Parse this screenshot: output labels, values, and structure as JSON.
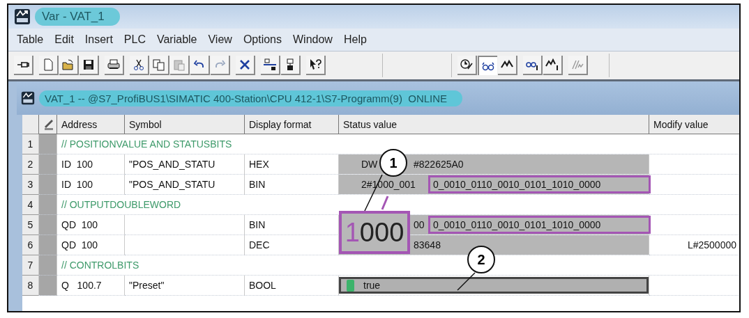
{
  "window": {
    "title": "Var - VAT_1"
  },
  "menu": [
    "Table",
    "Edit",
    "Insert",
    "PLC",
    "Variable",
    "View",
    "Options",
    "Window",
    "Help"
  ],
  "toolbars": [
    [
      [
        {
          "kind": "pin",
          "disabled": false,
          "pressed": false
        }
      ],
      [
        {
          "kind": "new",
          "disabled": false,
          "pressed": false
        },
        {
          "kind": "open",
          "disabled": false,
          "pressed": false
        },
        {
          "kind": "save",
          "disabled": false,
          "pressed": false
        }
      ],
      [
        {
          "kind": "print",
          "disabled": false,
          "pressed": false
        }
      ],
      [
        {
          "kind": "cut",
          "disabled": false,
          "pressed": false
        },
        {
          "kind": "copy",
          "disabled": false,
          "pressed": false
        },
        {
          "kind": "paste",
          "disabled": true,
          "pressed": false
        },
        {
          "kind": "undo",
          "disabled": false,
          "pressed": false
        },
        {
          "kind": "redo",
          "disabled": true,
          "pressed": false
        }
      ],
      [
        {
          "kind": "delete",
          "disabled": false,
          "pressed": false
        }
      ],
      [
        {
          "kind": "network",
          "disabled": false,
          "pressed": false
        },
        {
          "kind": "station",
          "disabled": false,
          "pressed": false
        }
      ],
      [
        {
          "kind": "help",
          "disabled": false,
          "pressed": false
        }
      ]
    ],
    [
      [
        {
          "kind": "monitor",
          "disabled": false,
          "pressed": false
        },
        {
          "kind": "glasses",
          "disabled": false,
          "pressed": true
        },
        {
          "kind": "modify",
          "disabled": false,
          "pressed": false
        }
      ],
      [
        {
          "kind": "glasses-trigger",
          "disabled": false,
          "pressed": false
        },
        {
          "kind": "modify-trigger",
          "disabled": false,
          "pressed": false
        }
      ],
      [
        {
          "kind": "force",
          "disabled": true,
          "pressed": false
        }
      ]
    ]
  ],
  "document": {
    "title": "VAT_1 -- @S7_ProfiBUS1\\SIMATIC 400-Station\\CPU 412-1\\S7-Programm(9)  ONLINE"
  },
  "table": {
    "columns": [
      "Address",
      "Symbol",
      "Display format",
      "Status value",
      "Modify value"
    ],
    "rows": [
      {
        "number": "1",
        "kind": "comment",
        "text": "// POSITIONVALUE AND STATUSBITS"
      },
      {
        "number": "2",
        "kind": "variable",
        "address": "ID  100",
        "symbol": "\"POS_AND_STATU",
        "format": "HEX",
        "status": {
          "kind": "value",
          "segments": [
            {
              "kind": "lead",
              "text": "DW"
            },
            {
              "kind": "after",
              "text": "#822625A0"
            }
          ]
        }
      },
      {
        "number": "3",
        "kind": "variable",
        "address": "ID  100",
        "symbol": "\"POS_AND_STATU",
        "format": "BIN",
        "status": {
          "kind": "value",
          "segments": [
            {
              "kind": "lead",
              "text": "2#1000_001"
            },
            {
              "kind": "boxed",
              "text": "0_0010_0110_0010_0101_1010_0000"
            }
          ]
        }
      },
      {
        "number": "4",
        "kind": "comment",
        "text": "// OUTPUTDOUBLEWORD"
      },
      {
        "number": "5",
        "kind": "variable",
        "address": "QD  100",
        "format": "BIN",
        "status": {
          "kind": "value",
          "segments": [
            {
              "kind": "after",
              "text": "00"
            },
            {
              "kind": "boxed",
              "text": "0_0010_0110_0010_0101_1010_0000"
            }
          ]
        }
      },
      {
        "number": "6",
        "kind": "variable",
        "address": "QD  100",
        "format": "DEC",
        "status": {
          "kind": "value",
          "segments": [
            {
              "kind": "after",
              "text": "83648"
            }
          ]
        },
        "modify": "L#2500000"
      },
      {
        "number": "7",
        "kind": "comment",
        "text": "// CONTROLBITS"
      },
      {
        "number": "8",
        "kind": "variable",
        "address": "Q   100.7",
        "symbol": "\"Preset\"",
        "format": "BOOL",
        "status": {
          "kind": "bool",
          "on": true,
          "segments": [
            {
              "kind": "lead",
              "text": "true"
            }
          ]
        }
      }
    ]
  },
  "magnifier": {
    "highlight": "1",
    "rest": "000"
  },
  "callouts": [
    "1",
    "2"
  ]
}
